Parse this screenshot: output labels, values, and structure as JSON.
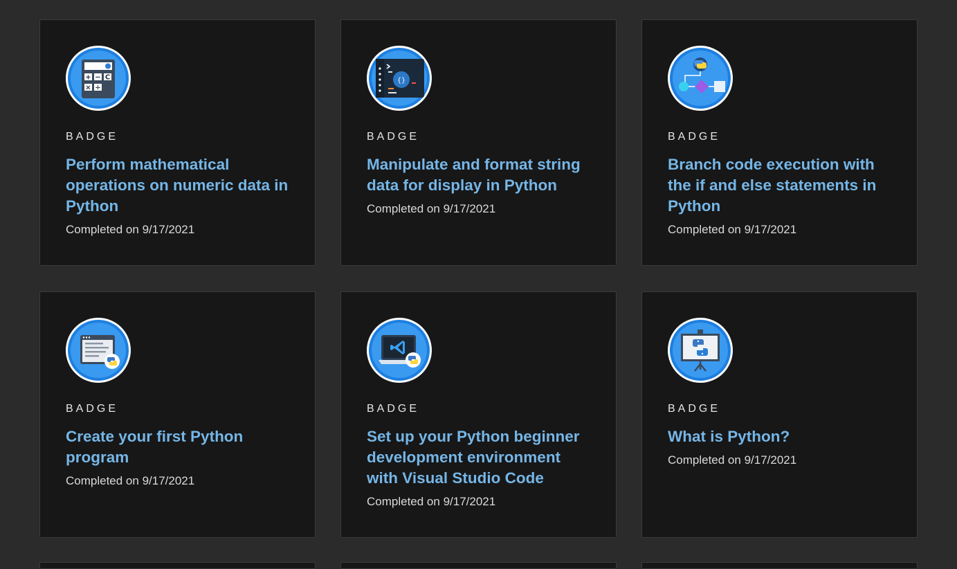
{
  "cards": [
    {
      "kicker": "BADGE",
      "title": "Perform mathematical operations on numeric data in Python",
      "completed": "Completed on 9/17/2021",
      "icon": "calculator-icon"
    },
    {
      "kicker": "BADGE",
      "title": "Manipulate and format string data for display in Python",
      "completed": "Completed on 9/17/2021",
      "icon": "code-editor-icon"
    },
    {
      "kicker": "BADGE",
      "title": "Branch code execution with the if and else statements in Python",
      "completed": "Completed on 9/17/2021",
      "icon": "flowchart-icon"
    },
    {
      "kicker": "BADGE",
      "title": "Create your first Python program",
      "completed": "Completed on 9/17/2021",
      "icon": "program-window-icon"
    },
    {
      "kicker": "BADGE",
      "title": "Set up your Python beginner development environment with Visual Studio Code",
      "completed": "Completed on 9/17/2021",
      "icon": "vscode-laptop-icon"
    },
    {
      "kicker": "BADGE",
      "title": "What is Python?",
      "completed": "Completed on 9/17/2021",
      "icon": "presentation-board-icon"
    }
  ],
  "colors": {
    "page_bg": "#2b2b2b",
    "card_bg": "#171717",
    "title_link": "#75b6e7",
    "badge_blue": "#2b8ee8"
  }
}
